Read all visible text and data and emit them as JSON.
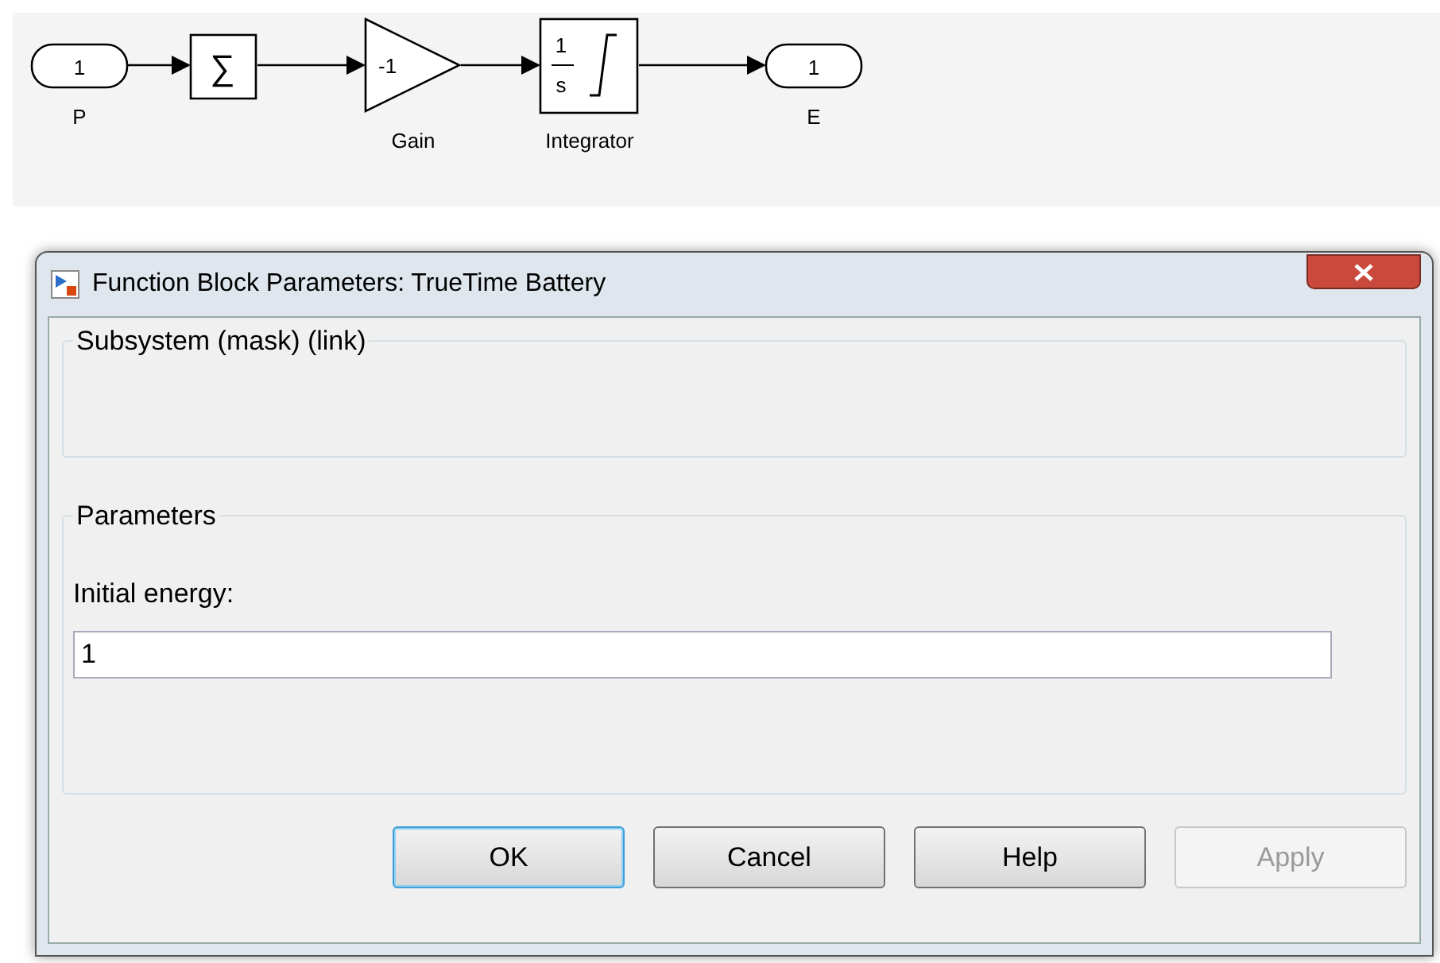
{
  "diagram": {
    "blocks": [
      {
        "kind": "inport",
        "value": "1",
        "label": "P"
      },
      {
        "kind": "sum",
        "value": "∑"
      },
      {
        "kind": "gain",
        "value": "-1",
        "label": "Gain"
      },
      {
        "kind": "integrator",
        "numerator": "1",
        "denominator": "s",
        "label": "Integrator"
      },
      {
        "kind": "outport",
        "value": "1",
        "label": "E"
      }
    ]
  },
  "dialog": {
    "title": "Function Block Parameters: TrueTime Battery",
    "mask_group": {
      "title": "Subsystem (mask) (link)"
    },
    "parameters_group": {
      "title": "Parameters",
      "field_label": "Initial energy:",
      "field_value": "1"
    },
    "buttons": [
      {
        "label": "OK",
        "default": true,
        "disabled": false
      },
      {
        "label": "Cancel",
        "default": false,
        "disabled": false
      },
      {
        "label": "Help",
        "default": false,
        "disabled": false
      },
      {
        "label": "Apply",
        "default": false,
        "disabled": true
      }
    ]
  }
}
